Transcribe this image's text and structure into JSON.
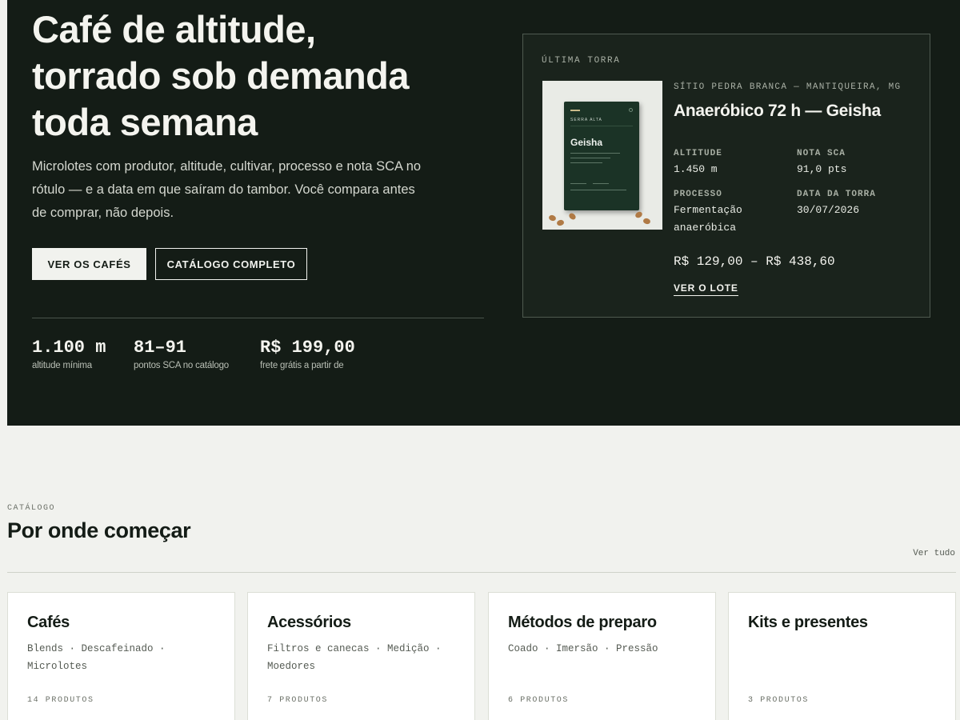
{
  "hero": {
    "title_lines": [
      "Café de altitude,",
      "torrado sob demanda",
      "toda semana"
    ],
    "subtitle": "Microlotes com produtor, altitude, cultivar, processo e nota SCA no rótulo — e a data em que saíram do tambor. Você compara antes de comprar, não depois.",
    "buttons": {
      "primary": "VER OS CAFÉS",
      "secondary": "CATÁLOGO COMPLETO"
    },
    "stats": [
      {
        "value": "1.100 m",
        "label": "altitude mínima"
      },
      {
        "value": "81–91",
        "label": "pontos SCA no catálogo"
      },
      {
        "value": "R$ 199,00",
        "label": "frete grátis a partir de"
      }
    ]
  },
  "lot": {
    "eyebrow": "ÚLTIMA TORRA",
    "origin": "SÍTIO PEDRA BRANCA — MANTIQUEIRA, MG",
    "name": "Anaeróbico 72 h — Geisha",
    "image": {
      "bag_brand": "SERRA ALTA",
      "bag_name": "Geisha"
    },
    "specs": [
      {
        "label": "ALTITUDE",
        "value": "1.450 m"
      },
      {
        "label": "NOTA SCA",
        "value": "91,0 pts"
      },
      {
        "label": "PROCESSO",
        "value": "Fermentação anaeróbica"
      },
      {
        "label": "DATA DA TORRA",
        "value": "30/07/2026"
      }
    ],
    "price": "R$ 129,00 – R$ 438,60",
    "link": "VER O LOTE"
  },
  "catalog": {
    "eyebrow": "CATÁLOGO",
    "title": "Por onde começar",
    "see_all": "Ver tudo",
    "cards": [
      {
        "title": "Cafés",
        "desc": "Blends · Descafeinado · Microlotes",
        "count": "14 PRODUTOS"
      },
      {
        "title": "Acessórios",
        "desc": "Filtros e canecas · Medição · Moedores",
        "count": "7 PRODUTOS"
      },
      {
        "title": "Métodos de preparo",
        "desc": "Coado · Imersão · Pressão",
        "count": "6 PRODUTOS"
      },
      {
        "title": "Kits e presentes",
        "desc": "",
        "count": "3 PRODUTOS"
      }
    ]
  },
  "colors": {
    "hero_bg": "#141c16",
    "page_bg": "#f1f2ee",
    "card_bg": "#ffffff",
    "bean": "#b07a45"
  }
}
